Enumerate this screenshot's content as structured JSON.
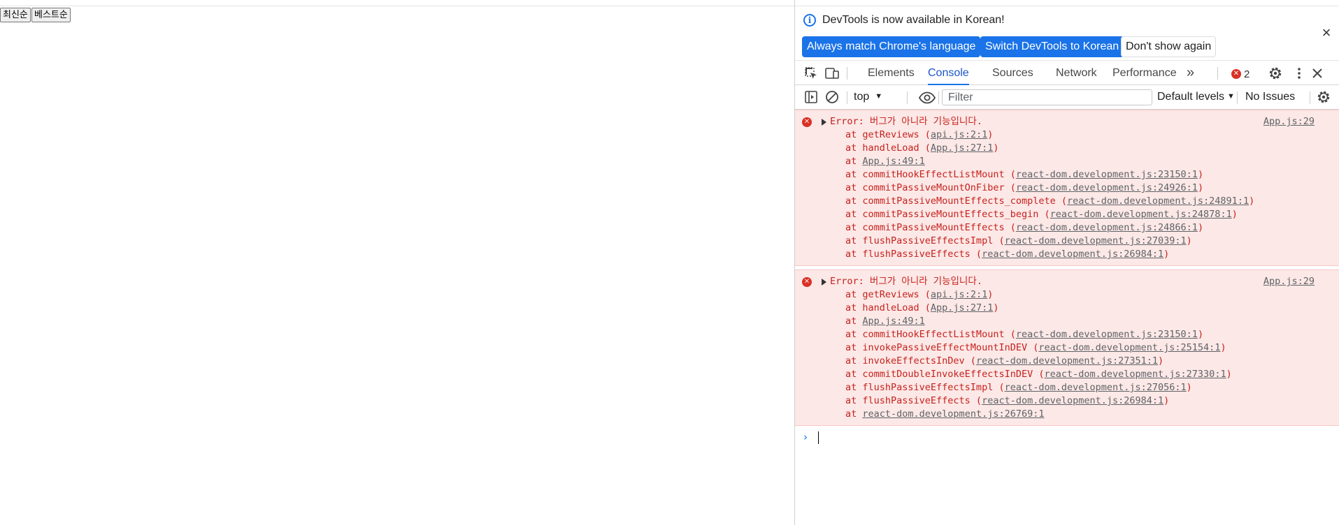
{
  "page": {
    "sort_latest": "최신순",
    "sort_best": "베스트순"
  },
  "infobar": {
    "message": "DevTools is now available in Korean!",
    "btn_match": "Always match Chrome's language",
    "btn_switch": "Switch DevTools to Korean",
    "btn_dismiss": "Don't show again",
    "close_icon": "close-icon"
  },
  "tabs": {
    "items": [
      "Elements",
      "Console",
      "Sources",
      "Network",
      "Performance"
    ],
    "active": "Console",
    "more": "»",
    "error_count": "2",
    "error_badge_symbol": "✕"
  },
  "console_toolbar": {
    "context": "top",
    "filter_placeholder": "Filter",
    "levels": "Default levels",
    "issues": "No Issues"
  },
  "messages": [
    {
      "text": "Error: 버그가 아니라 기능입니다.",
      "source": "App.js:29",
      "frames": [
        {
          "fn": "getReviews",
          "loc": "api.js:2:1"
        },
        {
          "fn": "handleLoad",
          "loc": "App.js:27:1"
        },
        {
          "fn": "",
          "loc": "App.js:49:1"
        },
        {
          "fn": "commitHookEffectListMount",
          "loc": "react-dom.development.js:23150:1"
        },
        {
          "fn": "commitPassiveMountOnFiber",
          "loc": "react-dom.development.js:24926:1"
        },
        {
          "fn": "commitPassiveMountEffects_complete",
          "loc": "react-dom.development.js:24891:1"
        },
        {
          "fn": "commitPassiveMountEffects_begin",
          "loc": "react-dom.development.js:24878:1"
        },
        {
          "fn": "commitPassiveMountEffects",
          "loc": "react-dom.development.js:24866:1"
        },
        {
          "fn": "flushPassiveEffectsImpl",
          "loc": "react-dom.development.js:27039:1"
        },
        {
          "fn": "flushPassiveEffects",
          "loc": "react-dom.development.js:26984:1"
        }
      ]
    },
    {
      "text": "Error: 버그가 아니라 기능입니다.",
      "source": "App.js:29",
      "frames": [
        {
          "fn": "getReviews",
          "loc": "api.js:2:1"
        },
        {
          "fn": "handleLoad",
          "loc": "App.js:27:1"
        },
        {
          "fn": "",
          "loc": "App.js:49:1"
        },
        {
          "fn": "commitHookEffectListMount",
          "loc": "react-dom.development.js:23150:1"
        },
        {
          "fn": "invokePassiveEffectMountInDEV",
          "loc": "react-dom.development.js:25154:1"
        },
        {
          "fn": "invokeEffectsInDev",
          "loc": "react-dom.development.js:27351:1"
        },
        {
          "fn": "commitDoubleInvokeEffectsInDEV",
          "loc": "react-dom.development.js:27330:1"
        },
        {
          "fn": "flushPassiveEffectsImpl",
          "loc": "react-dom.development.js:27056:1"
        },
        {
          "fn": "flushPassiveEffects",
          "loc": "react-dom.development.js:26984:1"
        },
        {
          "fn": "",
          "loc": "react-dom.development.js:26769:1"
        }
      ]
    }
  ],
  "prompt_symbol": "›",
  "colors": {
    "accent": "#1a73e8",
    "error_bg": "#fce8e6",
    "error_text": "#c5221f",
    "error_icon": "#d93025"
  }
}
